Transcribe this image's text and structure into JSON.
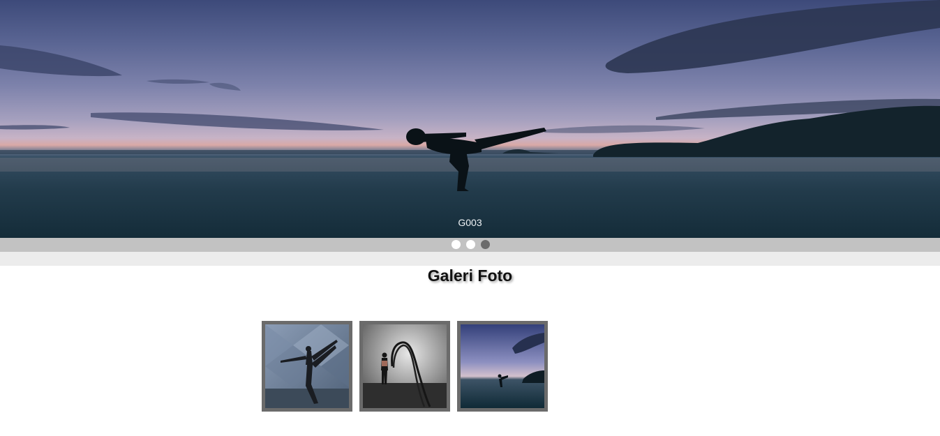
{
  "slider": {
    "caption": "G003",
    "slide_count": 3,
    "active_index": 2
  },
  "gallery": {
    "title": "Galeri Foto",
    "thumbnails": [
      {
        "name": "yoga-pose-studio"
      },
      {
        "name": "battle-ropes-gym"
      },
      {
        "name": "beach-kick-silhouette"
      }
    ]
  },
  "colors": {
    "dot_bar": "#c2c2c2",
    "strip": "#ececec",
    "thumb_border": "#6b6b6b",
    "dot_active": "#6b6b6b",
    "dot_inactive": "#ffffff"
  }
}
